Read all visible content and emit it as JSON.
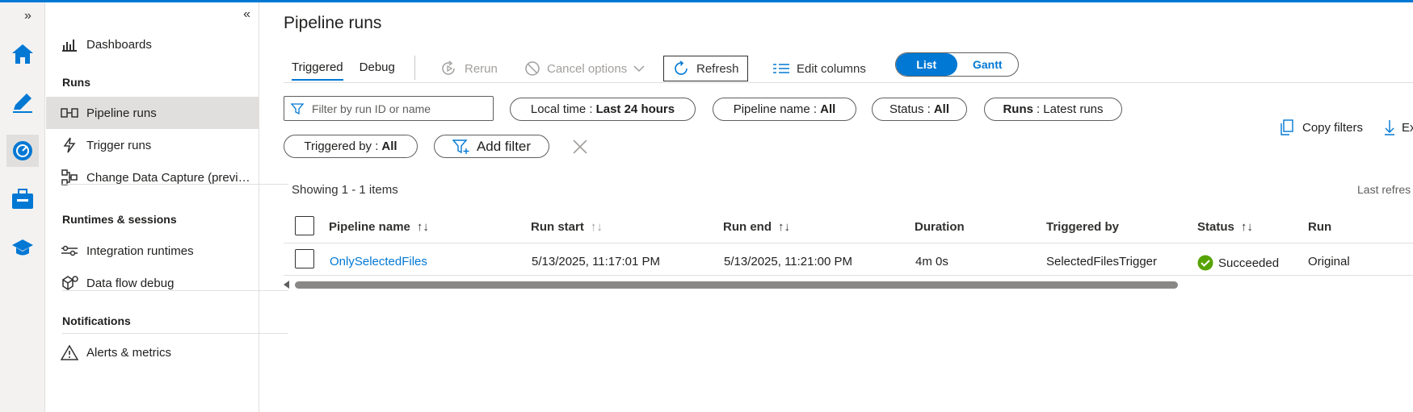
{
  "nav": {
    "items": [
      {
        "label": "Dashboards",
        "icon": "chart-icon"
      },
      {
        "label": "Pipeline runs",
        "icon": "pipeline-icon"
      },
      {
        "label": "Trigger runs",
        "icon": "trigger-icon"
      },
      {
        "label": "Change Data Capture (preview)",
        "icon": "cdc-icon"
      },
      {
        "label": "Integration runtimes",
        "icon": "runtime-icon"
      },
      {
        "label": "Data flow debug",
        "icon": "dataflow-icon"
      },
      {
        "label": "Alerts & metrics",
        "icon": "alert-icon"
      }
    ],
    "sections": {
      "runs": "Runs",
      "runtimes": "Runtimes & sessions",
      "notifications": "Notifications"
    }
  },
  "main": {
    "title": "Pipeline runs",
    "tabs": [
      "Triggered",
      "Debug"
    ],
    "toolbar": {
      "rerun": "Rerun",
      "cancel": "Cancel options",
      "refresh": "Refresh",
      "edit_columns": "Edit columns",
      "view_list": "List",
      "view_gantt": "Gantt"
    },
    "filters": {
      "search_placeholder": "Filter by run ID or name",
      "local_time_label": "Local time :",
      "local_time_value": "Last 24 hours",
      "pipeline_name_label": "Pipeline name :",
      "pipeline_name_value": "All",
      "status_label": "Status :",
      "status_value": "All",
      "runs_label": "Runs",
      "runs_value": ": Latest runs",
      "triggered_by_label": "Triggered by :",
      "triggered_by_value": "All",
      "add_filter": "Add filter",
      "copy_filters": "Copy filters",
      "export": "Ex"
    },
    "showing": "Showing 1 - 1 items",
    "last_refreshed": "Last refres",
    "columns": [
      "Pipeline name",
      "Run start",
      "Run end",
      "Duration",
      "Triggered by",
      "Status",
      "Run"
    ],
    "rows": [
      {
        "pipeline_name": "OnlySelectedFiles",
        "run_start": "5/13/2025, 11:17:01 PM",
        "run_end": "5/13/2025, 11:21:00 PM",
        "duration": "4m 0s",
        "triggered_by": "SelectedFilesTrigger",
        "status": "Succeeded",
        "run": "Original"
      }
    ]
  },
  "colors": {
    "accent": "#0078d4",
    "success": "#57a300"
  }
}
